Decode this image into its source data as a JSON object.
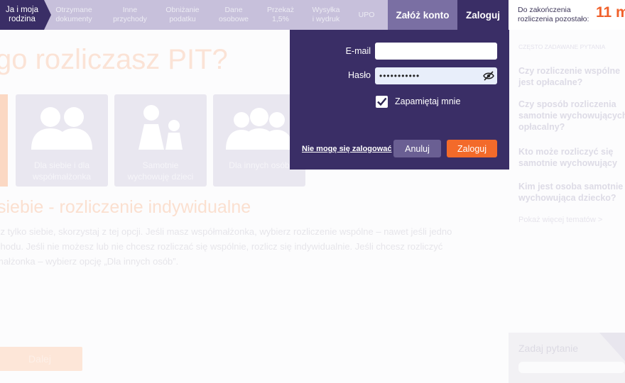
{
  "nav": {
    "steps": [
      {
        "label": "Ja i moja\nrodzina",
        "active": true
      },
      {
        "label": "Otrzymane\ndokumenty",
        "active": false
      },
      {
        "label": "Inne\nprzychody",
        "active": false
      },
      {
        "label": "Obniżanie\npodatku",
        "active": false
      },
      {
        "label": "Dane\nosobowe",
        "active": false
      },
      {
        "label": "Przekaż\n1,5%",
        "active": false
      },
      {
        "label": "Wysyłka\ni wydruk",
        "active": false
      },
      {
        "label": "UPO",
        "active": false
      }
    ],
    "register_label": "Załóż konto",
    "login_label": "Zaloguj",
    "deadline_label": "Do zakończenia\nrozliczenia pozostało:",
    "deadline_value": "11 m"
  },
  "main": {
    "heading": "go rozliczasz PIT?",
    "cards": [
      {
        "icon": "couple-icon",
        "label": "Dla siebie i dla\nwspółmałżonka"
      },
      {
        "icon": "single-parent-icon",
        "label": "Samotnie\nwychowuję dzieci"
      },
      {
        "icon": "group-icon",
        "label": "Dla innych osób"
      }
    ],
    "section_title": "siebie - rozliczenie indywidualne",
    "paragraph_lines": [
      "sz tylko siebie, skorzystaj z tej opcji. Jeśli masz współmałżonka, wybierz rozliczenie wspólne – nawet jeśli jedno",
      "chodu. Jeśli nie możesz lub nie chcesz rozliczać się wspólnie, rozlicz się indywidualnie. Jeśli chcesz rozliczyć",
      "małżonka – wybierz opcję „Dla innych osób”."
    ],
    "next_button": "Dalej"
  },
  "sidebar": {
    "faq_header": "CZĘSTO ZADAWANE PYTANIA",
    "faq": [
      "Czy rozliczenie wspólne\njest opłacalne?",
      "Czy sposób rozliczenia\nsamotnie wychowujących\nopłacalny?",
      "Kto może rozliczyć się\nsamotnie wychowujący",
      "Kim jest osoba samotnie\nwychowująca dziecko?"
    ],
    "more_link": "Pokaż więcej tematów >",
    "ask_title": "Zadaj pytanie"
  },
  "login": {
    "email_label": "E-mail",
    "email_value": "",
    "password_label": "Hasło",
    "password_value": "•••••••••••",
    "remember_label": "Zapamiętaj mnie",
    "remember_checked": true,
    "forgot_label": "Nie mogę się zalogować",
    "cancel_label": "Anuluj",
    "submit_label": "Zaloguj"
  },
  "colors": {
    "nav_dark": "#3a2e66",
    "accent_orange": "#f36a2a",
    "deadline_orange": "#f0602a"
  }
}
